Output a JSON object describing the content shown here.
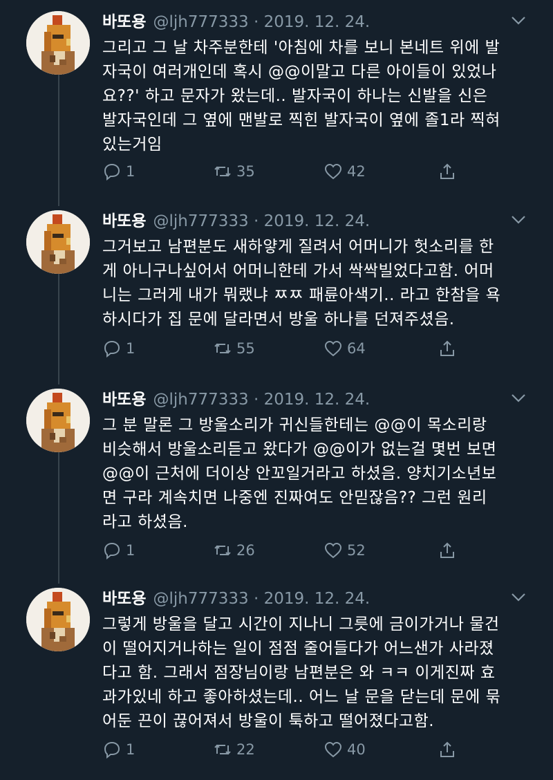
{
  "colors": {
    "background": "#15202b",
    "text": "#ffffff",
    "muted": "#8899a6",
    "thread_line": "#38444d"
  },
  "tweets": [
    {
      "name": "바또용",
      "handle": "@ljh777333",
      "separator": "·",
      "date": "2019. 12. 24.",
      "text": "그리고 그 날 차주분한테 '아침에 차를 보니 본네트 위에 발\n자국이 여러개인데 혹시 @@이말고 다른 아이들이 있었나\n요??' 하고 문자가 왔는데.. 발자국이 하나는 신발을 신은\n발자국인데 그 옆에 맨발로 찍힌 발자국이 옆에 졸1라 찍혀\n있는거임",
      "replies": "1",
      "retweets": "35",
      "likes": "42"
    },
    {
      "name": "바또용",
      "handle": "@ljh777333",
      "separator": "·",
      "date": "2019. 12. 24.",
      "text": "그거보고 남편분도 새하얗게 질려서 어머니가 헛소리를 한\n게 아니구나싶어서 어머니한테 가서 싹싹빌었다고함. 어머\n니는 그러게 내가 뭐랬냐 ㅉㅉ 패륜아색기.. 라고 한참을 욕\n하시다가 집 문에 달라면서 방울 하나를 던져주셨음.",
      "replies": "1",
      "retweets": "55",
      "likes": "64"
    },
    {
      "name": "바또용",
      "handle": "@ljh777333",
      "separator": "·",
      "date": "2019. 12. 24.",
      "text": "그 분 말론 그 방울소리가 귀신들한테는 @@이 목소리랑\n비슷해서 방울소리듣고 왔다가 @@이가 없는걸 몇번 보면\n@@이 근처에 더이상 안꼬일거라고 하셨음. 양치기소년보\n면 구라 계속치면 나중엔 진짜여도 안믿잖음?? 그런 원리\n라고 하셨음.",
      "replies": "1",
      "retweets": "26",
      "likes": "52"
    },
    {
      "name": "바또용",
      "handle": "@ljh777333",
      "separator": "·",
      "date": "2019. 12. 24.",
      "text": "그렇게 방울을 달고 시간이 지나니 그릇에 금이가거나 물건\n이 떨어지거나하는 일이 점점 줄어들다가 어느샌가 사라졌\n다고 함. 그래서 점장님이랑 남편분은 와 ㅋㅋ 이게진짜 효\n과가있네 하고 좋아하셨는데.. 어느 날 문을 닫는데 문에 묶\n어둔 끈이 끊어져서 방울이 툭하고 떨어졌다고함.",
      "replies": "1",
      "retweets": "22",
      "likes": "40"
    }
  ]
}
